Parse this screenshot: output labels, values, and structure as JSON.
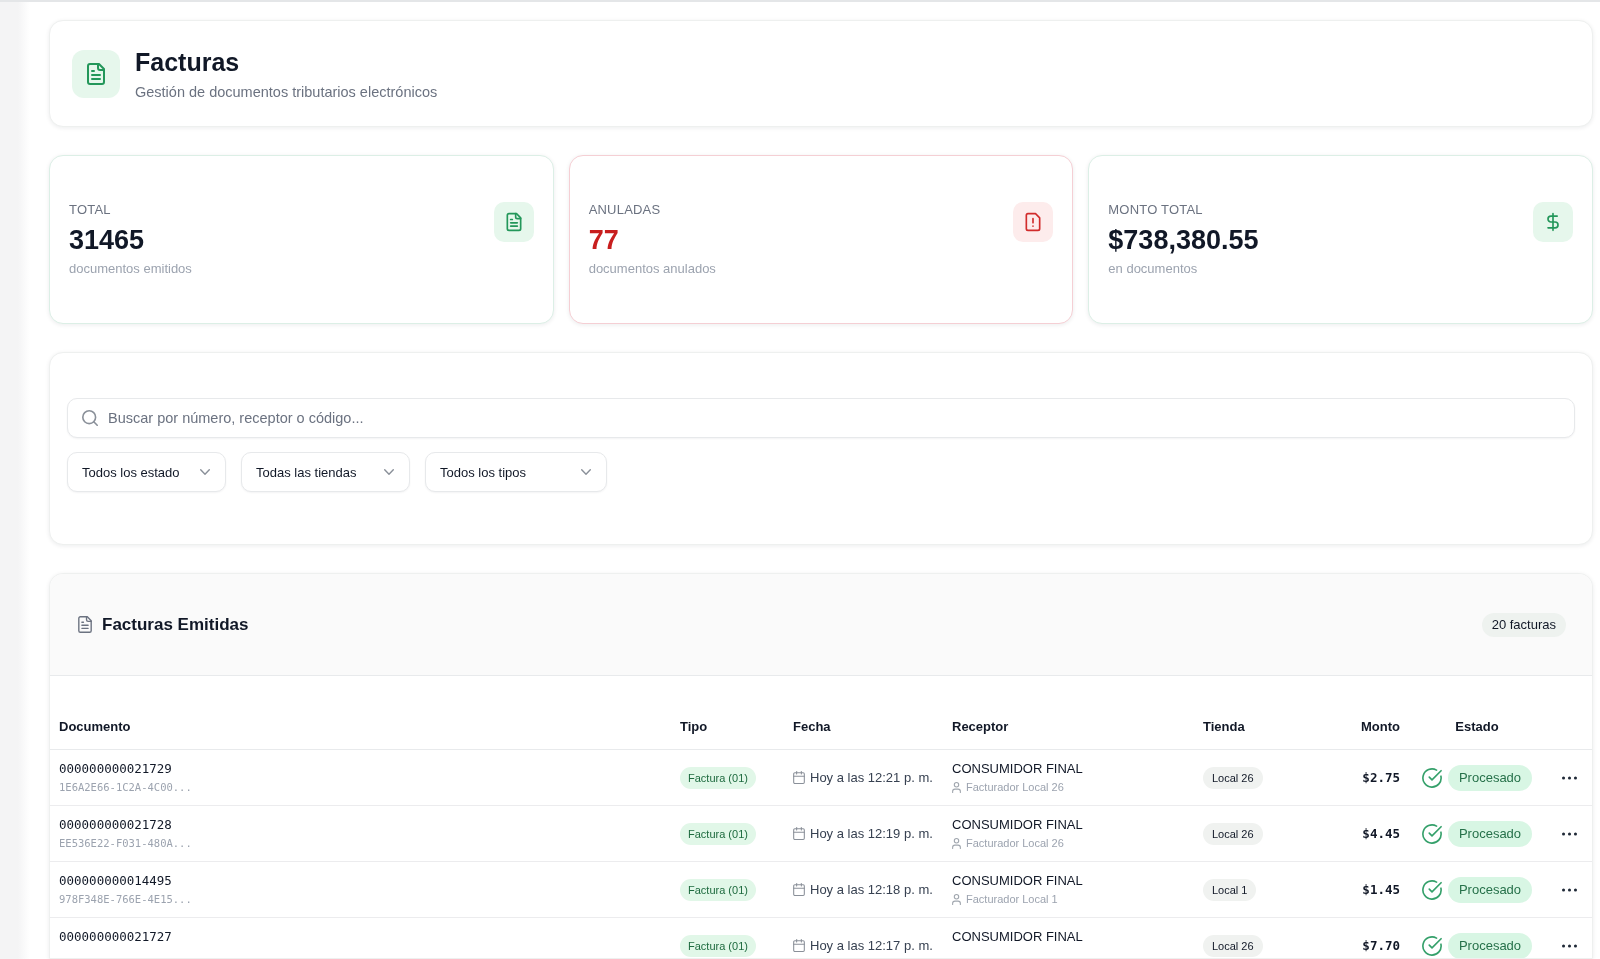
{
  "header": {
    "title": "Facturas",
    "subtitle": "Gestión de documentos tributarios electrónicos"
  },
  "stats": [
    {
      "kind": "document",
      "label": "TOTAL",
      "value": "31465",
      "caption": "documentos emitidos"
    },
    {
      "kind": "alert",
      "label": "ANULADAS",
      "value": "77",
      "caption": "documentos anulados"
    },
    {
      "kind": "money",
      "label": "MONTO TOTAL",
      "value": "$738,380.55",
      "caption": "en documentos"
    }
  ],
  "filters": {
    "search": {
      "placeholder": "Buscar por número, receptor o código..."
    },
    "dropdowns": [
      "Todos los estado",
      "Todas las tiendas",
      "Todos los tipos"
    ]
  },
  "invoices": {
    "title": "Facturas Emitidas",
    "count": "20 facturas",
    "columns": [
      "Documento",
      "Tipo",
      "Fecha",
      "Receptor",
      "Tienda",
      "Monto",
      "Estado"
    ],
    "rows": [
      {
        "number": "000000000021729",
        "code": "1E6A2E66-1C2A-4C00...",
        "type": "Factura (01)",
        "date": "Hoy a las 12:21 p. m.",
        "receiver": "CONSUMIDOR FINAL",
        "issuer": "Facturador Local 26",
        "store": "Local 26",
        "amount": "$2.75",
        "status": "Procesado"
      },
      {
        "number": "000000000021728",
        "code": "EE536E22-F031-480A...",
        "type": "Factura (01)",
        "date": "Hoy a las 12:19 p. m.",
        "receiver": "CONSUMIDOR FINAL",
        "issuer": "Facturador Local 26",
        "store": "Local 26",
        "amount": "$4.45",
        "status": "Procesado"
      },
      {
        "number": "000000000014495",
        "code": "978F348E-766E-4E15...",
        "type": "Factura (01)",
        "date": "Hoy a las 12:18 p. m.",
        "receiver": "CONSUMIDOR FINAL",
        "issuer": "Facturador Local 1",
        "store": "Local 1",
        "amount": "$1.45",
        "status": "Procesado"
      },
      {
        "number": "000000000021727",
        "type": "Factura (01)",
        "date": "Hoy a las 12:17 p. m.",
        "receiver": "CONSUMIDOR FINAL",
        "store": "Local 26",
        "amount": "$7.70",
        "status": "Procesado"
      }
    ]
  }
}
